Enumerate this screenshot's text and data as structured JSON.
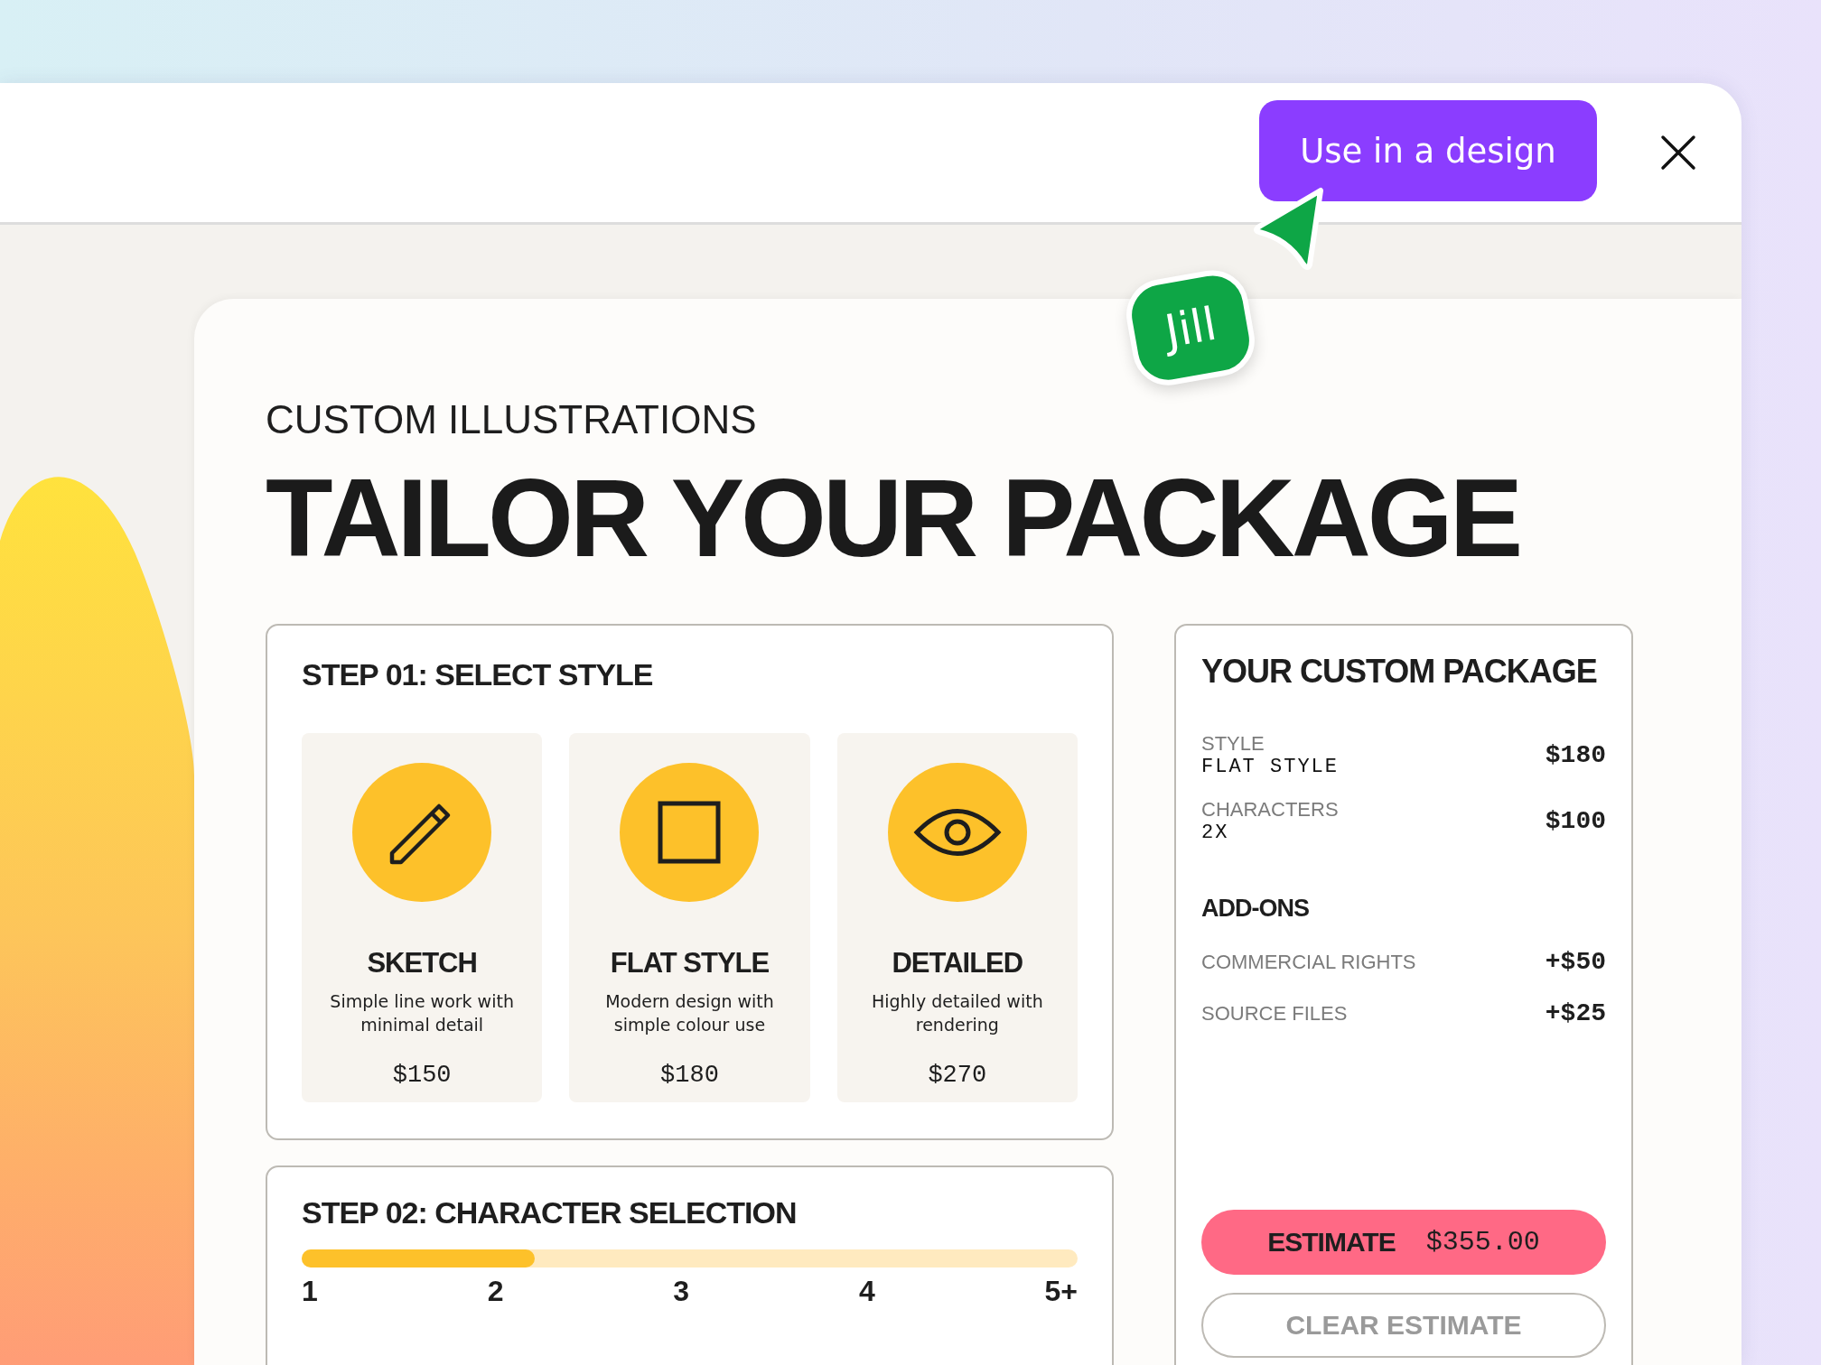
{
  "header": {
    "action_button": "Use in a design"
  },
  "collaborator_cursor": {
    "name": "Jill"
  },
  "page": {
    "eyebrow": "CUSTOM ILLUSTRATIONS",
    "title": "TAILOR YOUR PACKAGE"
  },
  "step_1": {
    "title": "STEP 01: SELECT STYLE",
    "options": [
      {
        "name": "SKETCH",
        "description": "Simple line work with minimal detail",
        "price": "$150"
      },
      {
        "name": "FLAT STYLE",
        "description": "Modern design with simple colour use",
        "price": "$180"
      },
      {
        "name": "DETAILED",
        "description": "Highly detailed with rendering",
        "price": "$270"
      }
    ]
  },
  "step_2": {
    "title": "STEP 02: CHARACTER SELECTION",
    "slider": {
      "level": 0.3,
      "labels": [
        "1",
        "2",
        "3",
        "4",
        "5+"
      ]
    }
  },
  "summary": {
    "title": "YOUR CUSTOM PACKAGE",
    "items": [
      {
        "label": "STYLE",
        "value": "FLAT STYLE",
        "price": "$180"
      },
      {
        "label": "CHARACTERS",
        "value": "2X",
        "price": "$100"
      }
    ],
    "addons_title": "ADD-ONS",
    "addons": [
      {
        "label": "COMMERCIAL RIGHTS",
        "price": "+$50"
      },
      {
        "label": "SOURCE FILES",
        "price": "+$25"
      }
    ],
    "estimate": {
      "label": "ESTIMATE",
      "amount": "$355.00"
    },
    "clear_button": {
      "label": "CLEAR ESTIMATE",
      "disabled": true
    }
  }
}
